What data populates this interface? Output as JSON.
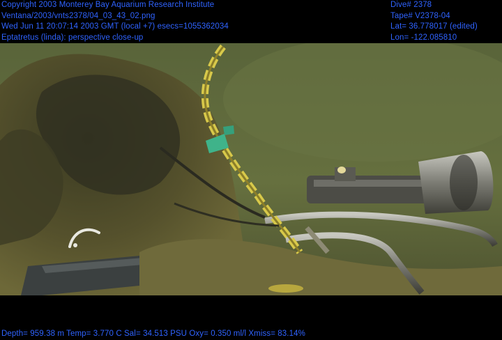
{
  "overlay": {
    "top_left": [
      "Copyright 2003 Monterey Bay Aquarium Research Institute",
      "Ventana/2003/vnts2378/04_03_43_02.png",
      "Wed Jun 11 20:07:14 2003 GMT (local +7)  esecs=1055362034",
      "Eptatretus (linda): perspective close-up"
    ],
    "top_right": [
      "Dive# 2378",
      "Tape# V2378-04",
      "Lat= 36.778017 (edited)",
      "Lon= -122.085810"
    ],
    "bottom": "Depth= 959.38 m  Temp= 3.770 C  Sal= 34.513 PSU  Oxy= 0.350 ml/l  Xmiss= 83.14%"
  },
  "colors": {
    "overlay_text": "#2f63ff",
    "water": "#5f6b3f",
    "sediment": "#6e6a3a",
    "rope": "#d8c94a"
  }
}
